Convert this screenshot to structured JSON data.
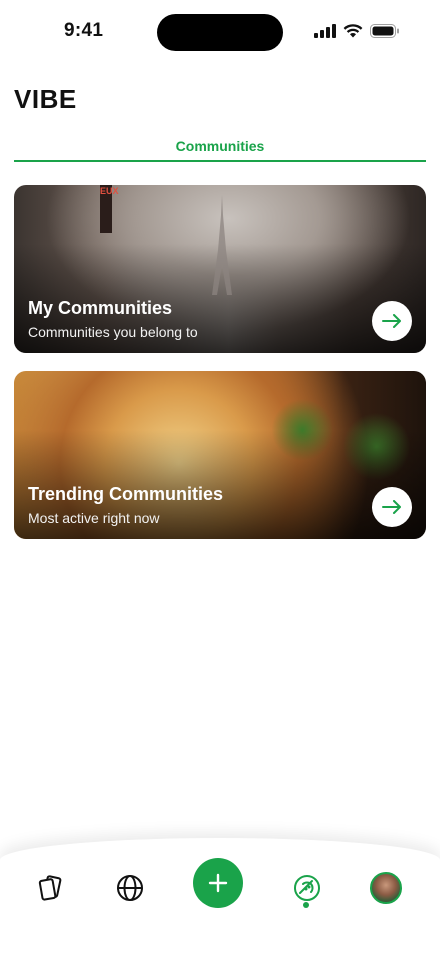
{
  "status_bar": {
    "time": "9:41"
  },
  "header": {
    "title": "VIBE"
  },
  "tabs": [
    {
      "label": "Communities",
      "active": true
    }
  ],
  "cards": [
    {
      "title": "My Communities",
      "subtitle": "Communities you belong to",
      "sign_text": "EUX"
    },
    {
      "title": "Trending Communities",
      "subtitle": "Most active right now"
    }
  ],
  "bottom_nav": {
    "items": [
      {
        "icon": "cards-icon"
      },
      {
        "icon": "globe-icon"
      },
      {
        "icon": "plus-icon"
      },
      {
        "icon": "food-icon",
        "active": true
      },
      {
        "icon": "avatar"
      }
    ]
  },
  "colors": {
    "accent": "#1aa34a",
    "background": "#ffffff",
    "text": "#111111"
  }
}
